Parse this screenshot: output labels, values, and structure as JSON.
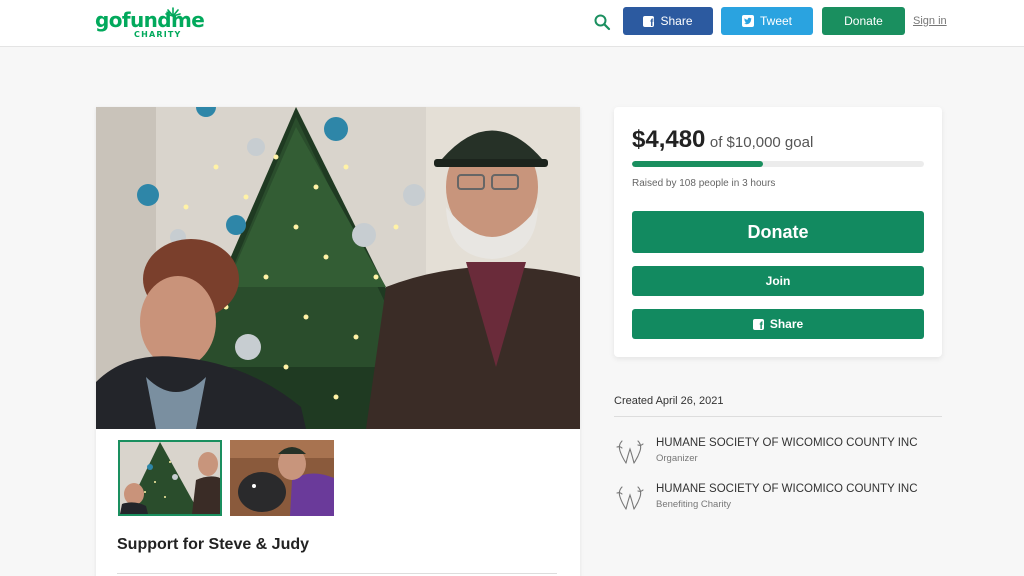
{
  "header": {
    "logo_word": "gofundme",
    "logo_sub": "CHARITY",
    "share_label": "Share",
    "tweet_label": "Tweet",
    "donate_label": "Donate",
    "signin_label": "Sign in"
  },
  "campaign": {
    "title": "Support for Steve & Judy"
  },
  "donation": {
    "amount": "$4,480",
    "goal": "of $10,000 goal",
    "progress": 0.448,
    "raised_by": "Raised by 108 people in 3 hours",
    "donate_label": "Donate",
    "join_label": "Join",
    "share_label": "Share"
  },
  "sidebar": {
    "created": "Created April 26, 2021",
    "orgs": [
      {
        "name": "HUMANE SOCIETY OF WICOMICO COUNTY INC",
        "role": "Organizer"
      },
      {
        "name": "HUMANE SOCIETY OF WICOMICO COUNTY INC",
        "role": "Benefiting Charity"
      }
    ]
  },
  "colors": {
    "brand_green": "#02a95c",
    "button_green": "#128a60",
    "facebook_blue": "#2c5aa0",
    "twitter_blue": "#2aa3e0"
  },
  "icons": [
    "search-icon",
    "facebook-icon",
    "twitter-icon",
    "humane-society-logo"
  ]
}
